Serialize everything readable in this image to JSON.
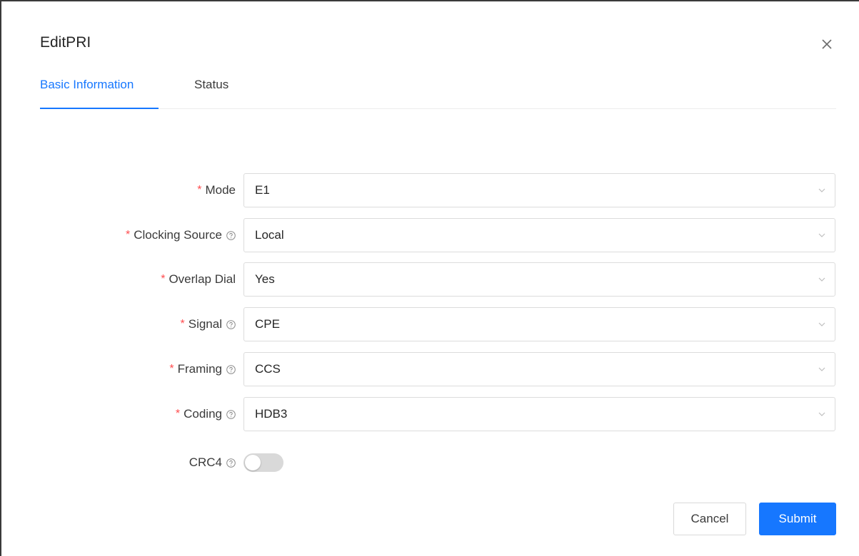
{
  "modal": {
    "title": "EditPRI",
    "tabs": [
      {
        "label": "Basic Information",
        "active": true
      },
      {
        "label": "Status",
        "active": false
      }
    ]
  },
  "form": {
    "required_mark": "*",
    "fields": [
      {
        "label": "Mode",
        "value": "E1",
        "required": true,
        "help": false
      },
      {
        "label": "Clocking Source",
        "value": "Local",
        "required": true,
        "help": true
      },
      {
        "label": "Overlap Dial",
        "value": "Yes",
        "required": true,
        "help": false
      },
      {
        "label": "Signal",
        "value": "CPE",
        "required": true,
        "help": true
      },
      {
        "label": "Framing",
        "value": "CCS",
        "required": true,
        "help": true
      },
      {
        "label": "Coding",
        "value": "HDB3",
        "required": true,
        "help": true
      }
    ],
    "crc4": {
      "label": "CRC4",
      "help": true,
      "enabled": false
    }
  },
  "footer": {
    "cancel_label": "Cancel",
    "submit_label": "Submit"
  },
  "colors": {
    "accent": "#1677ff",
    "required": "#ff4d4f",
    "switch_off": "#d9d9d9"
  },
  "icons": {
    "close": "close-icon",
    "help": "question-circle-icon",
    "dropdown": "chevron-down-icon"
  }
}
